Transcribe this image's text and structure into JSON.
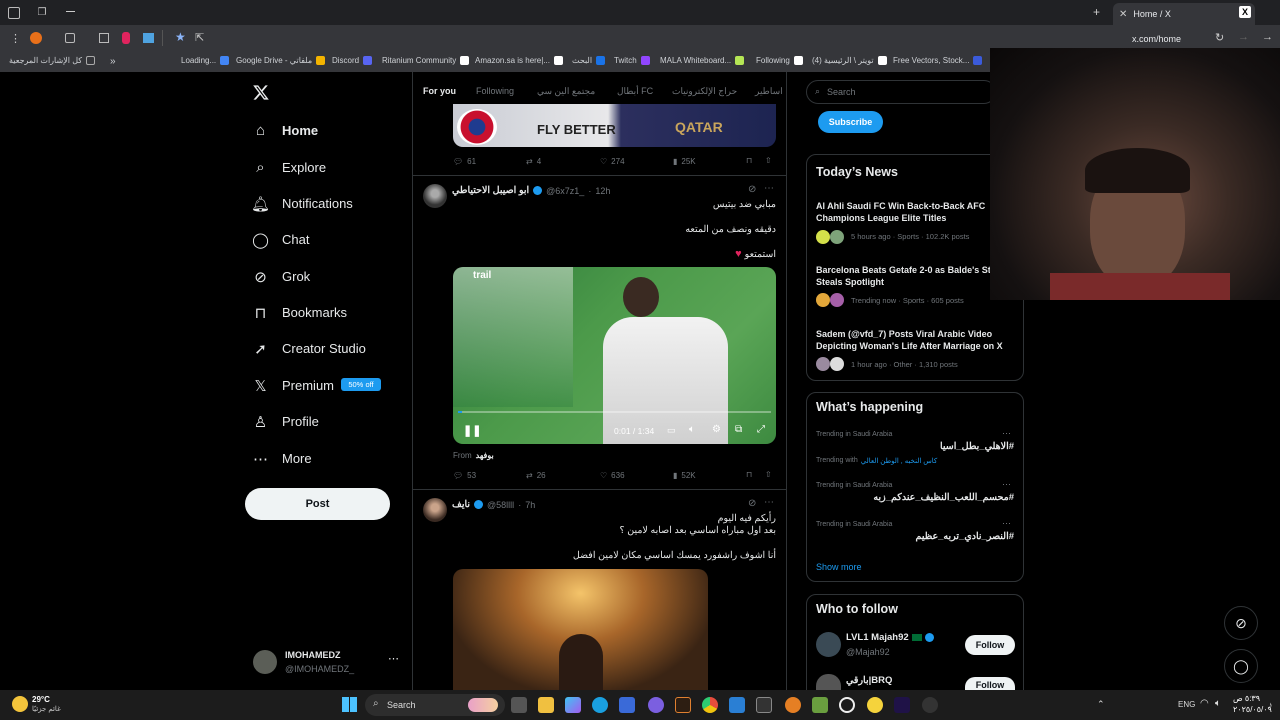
{
  "browser": {
    "tab_title": "Home / X",
    "url": "x.com/home",
    "bookmarks": [
      "كل الإشارات المرجعية",
      "Loading...",
      "Google Drive - ملفاتي",
      "Discord",
      "Ritanium Community",
      "Amazon.sa is here|...",
      "البحث",
      "Twitch",
      "MALA Whiteboard...",
      "Following",
      "(4) تويتر \\ الرئيسية",
      "Free Vectors, Stock..."
    ]
  },
  "sidebar": {
    "items": [
      {
        "label": "Home",
        "icon": "home-icon"
      },
      {
        "label": "Explore",
        "icon": "search-icon"
      },
      {
        "label": "Notifications",
        "icon": "bell-icon"
      },
      {
        "label": "Chat",
        "icon": "chat-icon"
      },
      {
        "label": "Grok",
        "icon": "grok-icon"
      },
      {
        "label": "Bookmarks",
        "icon": "bookmark-icon"
      },
      {
        "label": "Creator Studio",
        "icon": "rocket-icon"
      },
      {
        "label": "Premium",
        "icon": "x-logo-icon"
      },
      {
        "label": "Profile",
        "icon": "person-icon"
      },
      {
        "label": "More",
        "icon": "more-icon"
      }
    ],
    "premium_badge": "50% off",
    "post_button": "Post",
    "account_name": "IMOHAMEDZ",
    "account_handle": "@IMOHAMEDZ_"
  },
  "feed": {
    "tabs": [
      "For you",
      "Following",
      "مجتمع الين سي",
      "أبطال FC",
      "حراج الإلكترونيات",
      "اساطير"
    ],
    "top_actions": {
      "replies": "61",
      "reposts": "4",
      "likes": "274",
      "views": "25K"
    },
    "tweet1": {
      "name": "ابو اصيبل الاحتياطي",
      "handle": "@6x7z1_",
      "time": "12h",
      "lines": [
        "مبابي ضد بيتيس",
        "دقيقه ونصف من المتعه",
        "استمتعو"
      ],
      "video_time": "0:01 / 1:34",
      "from_label": "From",
      "from_source": "بوفهد",
      "replies": "53",
      "reposts": "26",
      "likes": "636",
      "views": "52K"
    },
    "tweet2": {
      "name": "نايف",
      "handle": "@58llll",
      "time": "7h",
      "lines": [
        "رأيكم فيه اليوم",
        "بعد اول مباراه اساسي بعد اصابه لامين ؟",
        "أنا اشوف راشفورد يمسك اساسي مكان لامين افضل"
      ]
    }
  },
  "right": {
    "search_placeholder": "Search",
    "subscribe": "Subscribe",
    "news_title": "Today’s News",
    "news": [
      {
        "title": "Al Ahli Saudi FC Win Back-to-Back AFC Champions League Elite Titles",
        "meta": "5 hours ago · Sports · 102.2K posts"
      },
      {
        "title": "Barcelona Beats Getafe 2-0 as Balde's St Face Steals Spotlight",
        "meta": "Trending now · Sports · 605 posts"
      },
      {
        "title": "Sadem (@vfd_7) Posts Viral Arabic Video Depicting Woman's Life After Marriage on X",
        "meta": "1 hour ago · Other · 1,310 posts"
      }
    ],
    "happening_title": "What’s happening",
    "trends": [
      {
        "context": "Trending in Saudi Arabia",
        "tag": "#الاهلي_بطل_اسيا",
        "with_label": "Trending with",
        "with": "كاس النخبه , الوطن العالي"
      },
      {
        "context": "Trending in Saudi Arabia",
        "tag": "#محسم_اللعب_النظيف_عندكم_زبه"
      },
      {
        "context": "Trending in Saudi Arabia",
        "tag": "#النصر_نادي_تربه_عظيم"
      }
    ],
    "show_more": "Show more",
    "who_title": "Who to follow",
    "follow": [
      {
        "name": "LVL1 Majah92",
        "handle": "@Majah92",
        "button": "Follow"
      },
      {
        "name": "بارقي|BRQ",
        "handle": "",
        "button": "Follow"
      }
    ]
  },
  "taskbar": {
    "weather_temp": "29°C",
    "weather_text": "غائم جزئيًا",
    "search": "Search",
    "lang": "ENG",
    "time": "٥:٣٩ ص",
    "date": "٢٠٢٥/٠٥/٠٩"
  }
}
